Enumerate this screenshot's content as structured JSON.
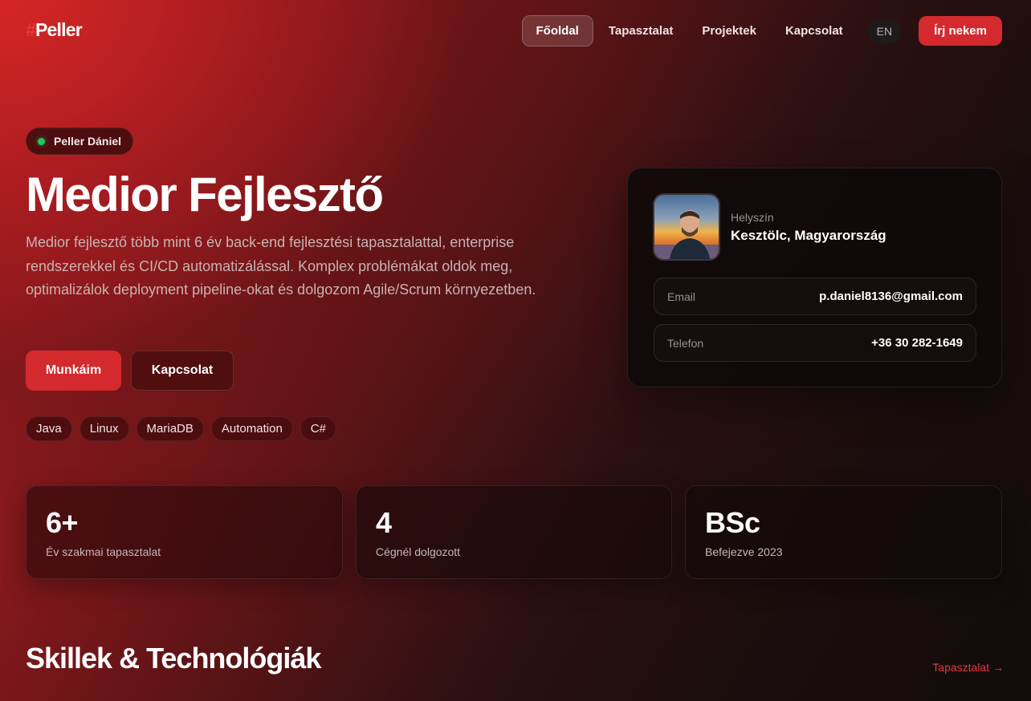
{
  "brand": {
    "hash": "#",
    "name": "Peller"
  },
  "nav": {
    "links": [
      {
        "label": "Főoldal",
        "active": true
      },
      {
        "label": "Tapasztalat",
        "active": false
      },
      {
        "label": "Projektek",
        "active": false
      },
      {
        "label": "Kapcsolat",
        "active": false
      }
    ],
    "language": "EN",
    "cta": "Írj nekem"
  },
  "hero": {
    "badge": "Peller Dániel",
    "title": "Medior Fejlesztő",
    "description": "Medior fejlesztő több mint 6 év back-end fejlesztési tapasztalattal, enterprise rendszerekkel és CI/CD automatizálással. Komplex problémákat oldok meg, optimalizálok deployment pipeline-okat és dolgozom Agile/Scrum környezetben.",
    "primary_button": "Munkáim",
    "secondary_button": "Kapcsolat",
    "tags": [
      "Java",
      "Linux",
      "MariaDB",
      "Automation",
      "C#"
    ]
  },
  "profile": {
    "location_label": "Helyszín",
    "location": "Kesztölc, Magyarország",
    "email_label": "Email",
    "email": "p.daniel8136@gmail.com",
    "phone_label": "Telefon",
    "phone": "+36 30 282-1649"
  },
  "stats": [
    {
      "value": "6+",
      "label": "Év szakmai tapasztalat"
    },
    {
      "value": "4",
      "label": "Cégnél dolgozott"
    },
    {
      "value": "BSc",
      "label": "Befejezve 2023"
    }
  ],
  "skills_section": {
    "title": "Skillek & Technológiák",
    "link": "Tapasztalat →"
  },
  "colors": {
    "accent": "#d42a2e",
    "status_online": "#22c55e"
  }
}
